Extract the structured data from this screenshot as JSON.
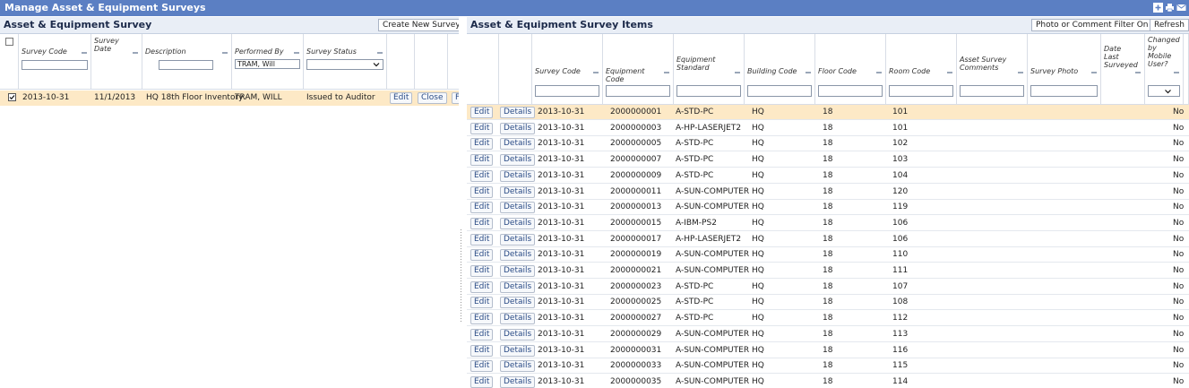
{
  "window": {
    "title": "Manage Asset & Equipment Surveys"
  },
  "left_panel": {
    "title": "Asset & Equipment Survey",
    "create_button": "Create New Survey",
    "columns": [
      {
        "label": "Survey Code",
        "filter": ""
      },
      {
        "label": "Survey Date",
        "filter": null
      },
      {
        "label": "Description",
        "filter": ""
      },
      {
        "label": "Performed By",
        "filter": "TRAM, Will"
      },
      {
        "label": "Survey Status",
        "filter": ""
      }
    ],
    "rows": [
      {
        "selected": true,
        "survey_code": "2013-10-31",
        "survey_date": "11/1/2013",
        "description": "HQ 18th Floor Inventory",
        "performed_by": "TRAM, WILL",
        "status": "Issued to Auditor",
        "actions": [
          "Edit",
          "Close",
          "F"
        ]
      }
    ]
  },
  "right_panel": {
    "title": "Asset & Equipment Survey Items",
    "photo_filter_button": "Photo or Comment Filter On",
    "refresh_button": "Refresh",
    "columns": [
      {
        "label": "Survey Code"
      },
      {
        "label": "Equipment Code"
      },
      {
        "label": "Equipment Standard"
      },
      {
        "label": "Building Code"
      },
      {
        "label": "Floor Code"
      },
      {
        "label": "Room Code"
      },
      {
        "label": "Asset Survey Comments"
      },
      {
        "label": "Survey Photo"
      },
      {
        "label": "Date Last Surveyed"
      },
      {
        "label": "Changed by Mobile User?"
      }
    ],
    "row_actions": {
      "edit": "Edit",
      "details": "Details"
    },
    "rows": [
      {
        "survey_code": "2013-10-31",
        "equipment_code": "2000000001",
        "standard": "A-STD-PC",
        "building": "HQ",
        "floor": "18",
        "room": "101",
        "changed": "No"
      },
      {
        "survey_code": "2013-10-31",
        "equipment_code": "2000000003",
        "standard": "A-HP-LASERJET2",
        "building": "HQ",
        "floor": "18",
        "room": "101",
        "changed": "No"
      },
      {
        "survey_code": "2013-10-31",
        "equipment_code": "2000000005",
        "standard": "A-STD-PC",
        "building": "HQ",
        "floor": "18",
        "room": "102",
        "changed": "No"
      },
      {
        "survey_code": "2013-10-31",
        "equipment_code": "2000000007",
        "standard": "A-STD-PC",
        "building": "HQ",
        "floor": "18",
        "room": "103",
        "changed": "No"
      },
      {
        "survey_code": "2013-10-31",
        "equipment_code": "2000000009",
        "standard": "A-STD-PC",
        "building": "HQ",
        "floor": "18",
        "room": "104",
        "changed": "No"
      },
      {
        "survey_code": "2013-10-31",
        "equipment_code": "2000000011",
        "standard": "A-SUN-COMPUTER",
        "building": "HQ",
        "floor": "18",
        "room": "120",
        "changed": "No"
      },
      {
        "survey_code": "2013-10-31",
        "equipment_code": "2000000013",
        "standard": "A-SUN-COMPUTER",
        "building": "HQ",
        "floor": "18",
        "room": "119",
        "changed": "No"
      },
      {
        "survey_code": "2013-10-31",
        "equipment_code": "2000000015",
        "standard": "A-IBM-PS2",
        "building": "HQ",
        "floor": "18",
        "room": "106",
        "changed": "No"
      },
      {
        "survey_code": "2013-10-31",
        "equipment_code": "2000000017",
        "standard": "A-HP-LASERJET2",
        "building": "HQ",
        "floor": "18",
        "room": "106",
        "changed": "No"
      },
      {
        "survey_code": "2013-10-31",
        "equipment_code": "2000000019",
        "standard": "A-SUN-COMPUTER",
        "building": "HQ",
        "floor": "18",
        "room": "110",
        "changed": "No"
      },
      {
        "survey_code": "2013-10-31",
        "equipment_code": "2000000021",
        "standard": "A-SUN-COMPUTER",
        "building": "HQ",
        "floor": "18",
        "room": "111",
        "changed": "No"
      },
      {
        "survey_code": "2013-10-31",
        "equipment_code": "2000000023",
        "standard": "A-STD-PC",
        "building": "HQ",
        "floor": "18",
        "room": "107",
        "changed": "No"
      },
      {
        "survey_code": "2013-10-31",
        "equipment_code": "2000000025",
        "standard": "A-STD-PC",
        "building": "HQ",
        "floor": "18",
        "room": "108",
        "changed": "No"
      },
      {
        "survey_code": "2013-10-31",
        "equipment_code": "2000000027",
        "standard": "A-STD-PC",
        "building": "HQ",
        "floor": "18",
        "room": "112",
        "changed": "No"
      },
      {
        "survey_code": "2013-10-31",
        "equipment_code": "2000000029",
        "standard": "A-SUN-COMPUTER",
        "building": "HQ",
        "floor": "18",
        "room": "113",
        "changed": "No"
      },
      {
        "survey_code": "2013-10-31",
        "equipment_code": "2000000031",
        "standard": "A-SUN-COMPUTER",
        "building": "HQ",
        "floor": "18",
        "room": "116",
        "changed": "No"
      },
      {
        "survey_code": "2013-10-31",
        "equipment_code": "2000000033",
        "standard": "A-SUN-COMPUTER",
        "building": "HQ",
        "floor": "18",
        "room": "115",
        "changed": "No"
      },
      {
        "survey_code": "2013-10-31",
        "equipment_code": "2000000035",
        "standard": "A-SUN-COMPUTER",
        "building": "HQ",
        "floor": "18",
        "room": "114",
        "changed": "No"
      }
    ]
  },
  "icons": [
    "add-icon",
    "print-icon",
    "email-icon",
    "chevron-down-icon"
  ],
  "colors": {
    "titlebar": "#5b7fc3",
    "panel_header": "#e9eef6",
    "selected_row": "#fde9c6",
    "link_text": "#2b4c86"
  }
}
